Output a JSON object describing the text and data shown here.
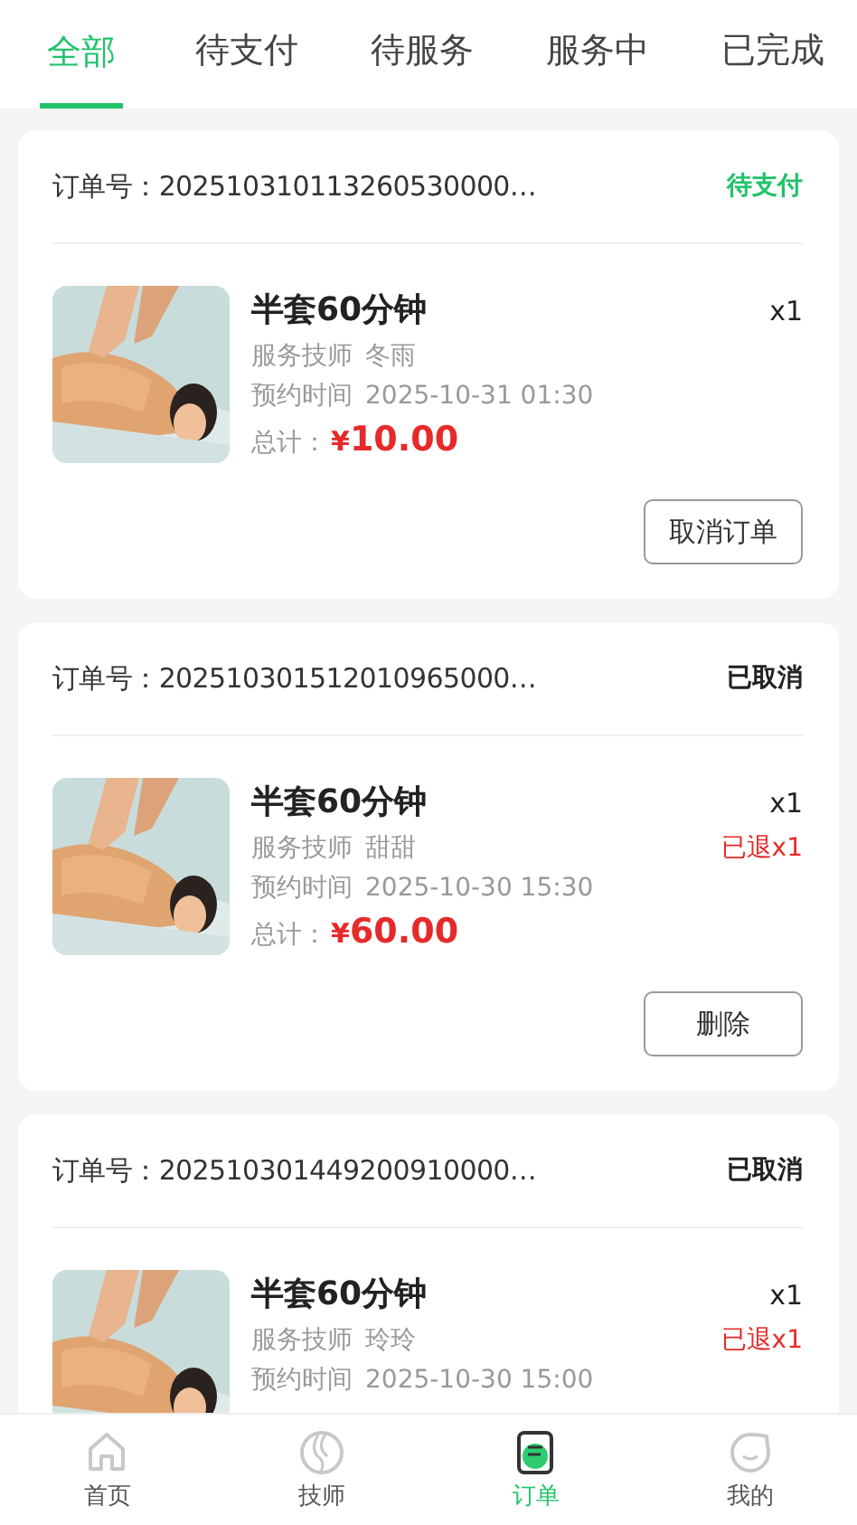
{
  "tabs": [
    {
      "label": "全部",
      "selected": true
    },
    {
      "label": "待支付",
      "selected": false
    },
    {
      "label": "待服务",
      "selected": false
    },
    {
      "label": "服务中",
      "selected": false
    },
    {
      "label": "已完成",
      "selected": false
    }
  ],
  "orders": [
    {
      "order_label": "订单号：",
      "order_no": "202510310113260530000…",
      "status": "待支付",
      "kind": "pending",
      "title": "半套60分钟",
      "qty": "x1",
      "tech_label": "服务技师",
      "tech": "冬雨",
      "time_label": "预约时间",
      "time": "2025-10-31 01:30",
      "total_label": "总计：",
      "currency": "¥",
      "total": "10.00",
      "action": "取消订单"
    },
    {
      "order_label": "订单号：",
      "order_no": "202510301512010965000…",
      "status": "已取消",
      "kind": "cancelled",
      "title": "半套60分钟",
      "qty": "x1",
      "refund": "已退x1",
      "tech_label": "服务技师",
      "tech": "甜甜",
      "time_label": "预约时间",
      "time": "2025-10-30 15:30",
      "total_label": "总计：",
      "currency": "¥",
      "total": "60.00",
      "action": "删除"
    },
    {
      "order_label": "订单号：",
      "order_no": "202510301449200910000…",
      "status": "已取消",
      "kind": "cancelled",
      "title": "半套60分钟",
      "qty": "x1",
      "refund": "已退x1",
      "tech_label": "服务技师",
      "tech": "玲玲",
      "time_label": "预约时间",
      "time": "2025-10-30 15:00"
    }
  ],
  "nav": [
    {
      "kind": "home",
      "label": "首页",
      "selected": false
    },
    {
      "kind": "tech",
      "label": "技师",
      "selected": false
    },
    {
      "kind": "order",
      "label": "订单",
      "selected": true
    },
    {
      "kind": "mine",
      "label": "我的",
      "selected": false
    }
  ]
}
